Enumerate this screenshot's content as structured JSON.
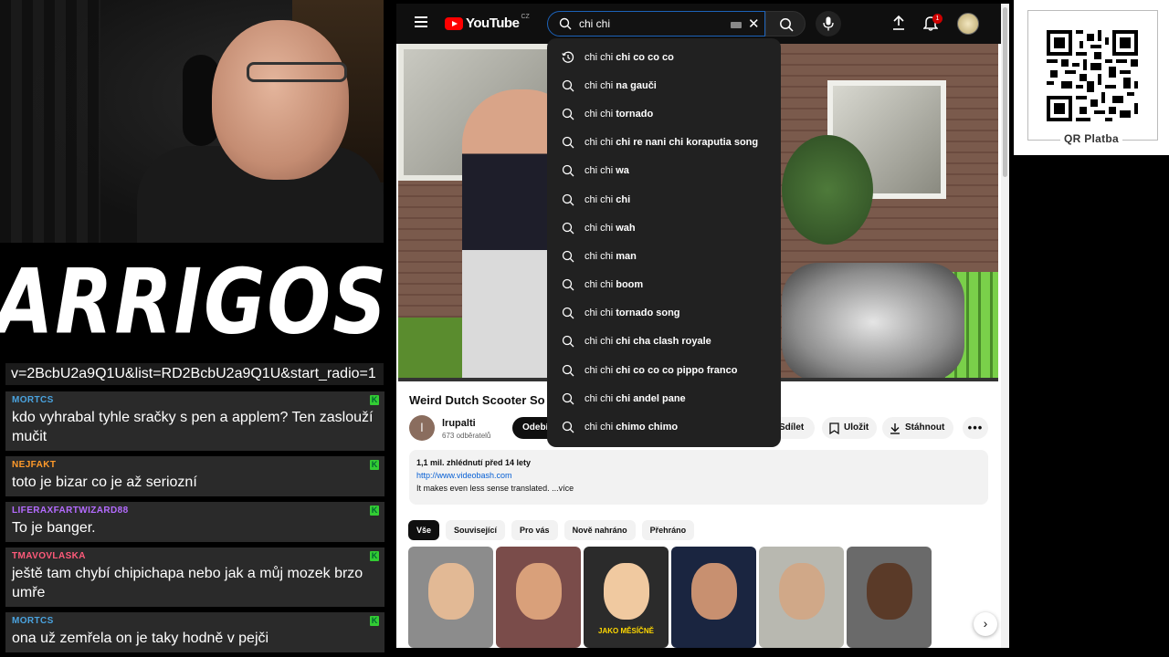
{
  "overlay": {
    "logo_text": "ARRIGOS",
    "url_fragment": "v=2BcbU2a9Q1U&list=RD2BcbU2a9Q1U&start_radio=1",
    "chat": [
      {
        "user": "MORTCS",
        "user_color": "#4aa3df",
        "text": "kdo vyhrabal tyhle sračky s pen a applem? Ten zaslouží mučit"
      },
      {
        "user": "NEJFAKT",
        "user_color": "#ff9a2a",
        "text": "toto je bizar co je až seriozní"
      },
      {
        "user": "LIFERAXFARTWIZARD88",
        "user_color": "#b46bff",
        "text": "To je banger."
      },
      {
        "user": "TMAVOVLASKA",
        "user_color": "#ff5a7a",
        "text": "ještě tam chybí chipichapa nebo jak a můj mozek brzo umře"
      },
      {
        "user": "MORTCS",
        "user_color": "#4aa3df",
        "text": "ona už zemřela on je taky hodně v pejči"
      }
    ],
    "chat_badge": "K"
  },
  "youtube": {
    "logo_word": "YouTube",
    "logo_region": "CZ",
    "search_value": "chi chi",
    "notification_count": "1",
    "suggestions": [
      {
        "prefix": "chi chi",
        "rest": " chi co co co",
        "icon": "history-icon"
      },
      {
        "prefix": "chi chi",
        "rest": " na gauči",
        "icon": "search-icon"
      },
      {
        "prefix": "chi chi",
        "rest": " tornado",
        "icon": "search-icon"
      },
      {
        "prefix": "chi chi",
        "rest": " chi re nani chi koraputia song",
        "icon": "search-icon"
      },
      {
        "prefix": "chi chi",
        "rest": " wa",
        "icon": "search-icon"
      },
      {
        "prefix": "chi chi",
        "rest": " chi",
        "icon": "search-icon"
      },
      {
        "prefix": "chi chi",
        "rest": " wah",
        "icon": "search-icon"
      },
      {
        "prefix": "chi chi",
        "rest": " man",
        "icon": "search-icon"
      },
      {
        "prefix": "chi chi",
        "rest": " boom",
        "icon": "search-icon"
      },
      {
        "prefix": "chi chi",
        "rest": " tornado song",
        "icon": "search-icon"
      },
      {
        "prefix": "chi chi",
        "rest": " chi cha clash royale",
        "icon": "search-icon"
      },
      {
        "prefix": "chi chi",
        "rest": " chi co co co pippo franco",
        "icon": "search-icon"
      },
      {
        "prefix": "chi chi",
        "rest": " chi andel pane",
        "icon": "search-icon"
      },
      {
        "prefix": "chi chi",
        "rest": " chimo chimo",
        "icon": "search-icon"
      }
    ],
    "video": {
      "title": "Weird Dutch Scooter So",
      "channel_initial": "l",
      "channel_name": "lrupalti",
      "subscribers": "673 odběratelů",
      "subscribe_label": "Odebí",
      "share_label": "Sdílet",
      "save_label": "Uložit",
      "download_label": "Stáhnout",
      "more_label": "•••",
      "views_date": "1,1 mil. zhlédnutí  před 14 lety",
      "desc_link": "http://www.videobash.com",
      "desc_text": "It makes even less sense translated. ...více"
    },
    "chips": [
      "Vše",
      "Související",
      "Pro vás",
      "Nově nahráno",
      "Přehráno"
    ],
    "thumbnails": [
      {
        "caption": "",
        "bg": "#8c8c8c",
        "face": "#e2b995"
      },
      {
        "caption": "",
        "bg": "#7a4c4a",
        "face": "#d9a07a"
      },
      {
        "caption": "JAKO MĚSÍČNĚ",
        "bg": "#2b2b2b",
        "face": "#f0c9a0"
      },
      {
        "caption": "",
        "bg": "#1a2540",
        "face": "#c89070"
      },
      {
        "caption": "",
        "bg": "#b8b8b0",
        "face": "#d0a888"
      },
      {
        "caption": "",
        "bg": "#6a6a6a",
        "face": "#5a3a28"
      }
    ],
    "next_label": "›"
  },
  "qr": {
    "label": "QR Platba"
  }
}
